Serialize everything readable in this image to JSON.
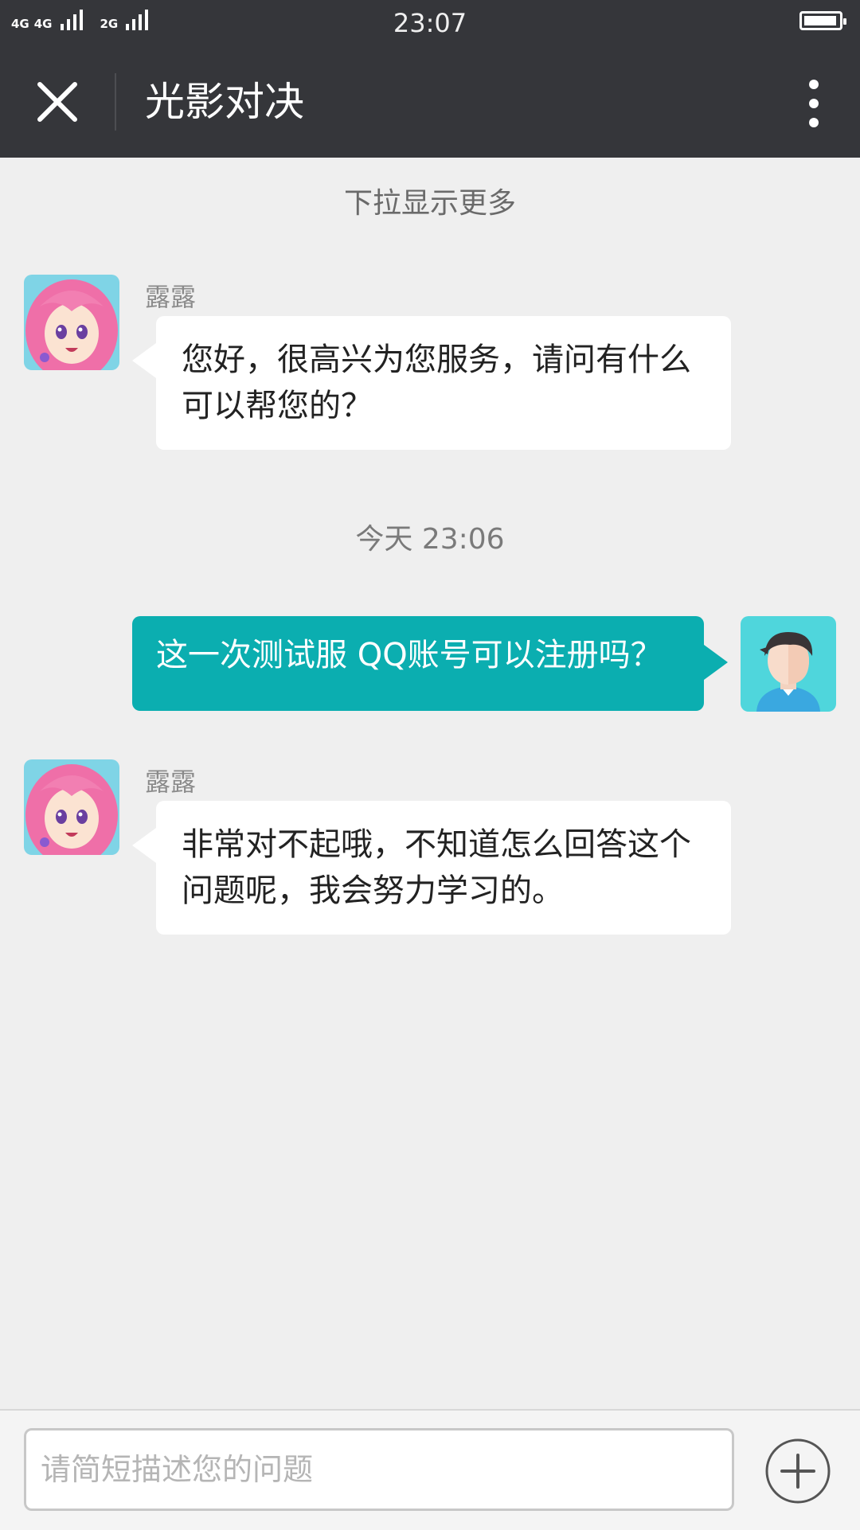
{
  "status_bar": {
    "signal1_label": "4G",
    "signal2_label": "4G",
    "signal3_label": "2G",
    "time": "23:07",
    "battery_icon": "battery-icon"
  },
  "header": {
    "title": "光影对决",
    "close_icon": "close-icon",
    "more_icon": "more-vertical-icon"
  },
  "chat": {
    "load_more_hint": "下拉显示更多",
    "messages": [
      {
        "direction": "incoming",
        "sender": "露露",
        "avatar": "anime-girl-avatar",
        "text": "您好，很高兴为您服务，请问有什么可以帮您的？"
      },
      {
        "type": "timestamp",
        "text": "今天 23:06"
      },
      {
        "direction": "outgoing",
        "avatar": "user-avatar",
        "text": "这一次测试服 QQ账号可以注册吗？"
      },
      {
        "direction": "incoming",
        "sender": "露露",
        "avatar": "anime-girl-avatar",
        "text": "非常对不起哦，不知道怎么回答这个问题呢，我会努力学习的。"
      }
    ]
  },
  "composer": {
    "value": "",
    "placeholder": "请简短描述您的问题",
    "add_icon": "plus-circle-icon"
  },
  "colors": {
    "header_bg": "#35363a",
    "page_bg": "#efefef",
    "outgoing_bubble": "#0baeb0",
    "incoming_bubble": "#ffffff"
  }
}
